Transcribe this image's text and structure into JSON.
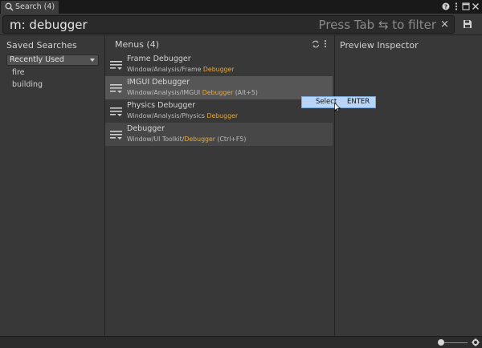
{
  "window": {
    "tab_title": "Search (4)",
    "controls": [
      "help-icon",
      "more-icon",
      "maximize-icon",
      "close-icon"
    ]
  },
  "search": {
    "query": "m: debugger",
    "hint": "Press Tab ⇆ to filter",
    "clear_label": "×"
  },
  "saved_searches": {
    "title": "Saved Searches",
    "dropdown_value": "Recently Used",
    "items": [
      "fire",
      "building"
    ]
  },
  "menus": {
    "title": "Menus (4)",
    "rows": [
      {
        "name": "Frame Debugger",
        "path_prefix": "Window/Analysis/Frame ",
        "path_highlight": "Debugger",
        "path_suffix": ""
      },
      {
        "name": "IMGUI Debugger",
        "path_prefix": "Window/Analysis/IMGUI ",
        "path_highlight": "Debugger",
        "path_suffix": " (Alt+5)"
      },
      {
        "name": "Physics Debugger",
        "path_prefix": "Window/Analysis/Physics ",
        "path_highlight": "Debugger",
        "path_suffix": ""
      },
      {
        "name": "Debugger",
        "path_prefix": "Window/UI Toolkit/",
        "path_highlight": "Debugger",
        "path_suffix": " (Ctrl+F5)"
      }
    ]
  },
  "context_menu": {
    "select_label": "Select",
    "shortcut": "ENTER"
  },
  "preview": {
    "title": "Preview Inspector"
  },
  "colors": {
    "highlight": "#e7a93a",
    "panel": "#383838",
    "selected_row": "#565656",
    "context_bg": "#b8d5f7"
  }
}
